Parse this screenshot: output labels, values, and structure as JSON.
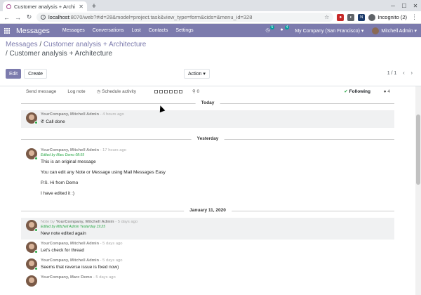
{
  "browser": {
    "tab_title": "Customer analysis + Archi",
    "url_host": "localhost",
    "url_rest": ":8070/web?#id=28&model=project.task&view_type=form&cids=&menu_id=328",
    "incognito_label": "Incognito (2)"
  },
  "navbar": {
    "app_name": "Messages",
    "menu": [
      "Messages",
      "Conversations",
      "Lost",
      "Contacts",
      "Settings"
    ],
    "activity_badge": "5",
    "chat_badge": "4",
    "company": "My Company (San Francisco)",
    "user": "Mitchell Admin"
  },
  "control_panel": {
    "breadcrumb_parent": "Messages",
    "breadcrumb_mid": "Customer analysis + Architecture",
    "breadcrumb_current": "/ Customer analysis + Architecture",
    "edit_label": "Edit",
    "create_label": "Create",
    "action_label": "Action",
    "pager": "1 / 1"
  },
  "chatter": {
    "send_message": "Send message",
    "log_note": "Log note",
    "schedule_activity": "Schedule activity",
    "attachments": "0",
    "following": "Following",
    "followers": "4"
  },
  "sections": [
    {
      "date": "Today",
      "messages": [
        {
          "author": "YourCompany, Mitchell Admin",
          "time": " - 4 hours ago",
          "body": [
            "Call done"
          ],
          "note": true
        }
      ]
    },
    {
      "date": "Yesterday",
      "messages": [
        {
          "author": "YourCompany, Mitchell Admin",
          "time": " - 17 hours ago",
          "edited": "Edited by Marc Demo 08:59",
          "body": [
            "This is an original message",
            "You can edit any Note or Message using Mail Messages Easy",
            "P.S. Hi from Demo",
            "I have edited it :)"
          ]
        }
      ]
    },
    {
      "date": "January 11, 2020",
      "messages": [
        {
          "note_lbl": "Note by ",
          "author": "YourCompany, Mitchell Admin",
          "time": " - 5 days ago",
          "edited": "Edited by Mitchell Admin Yesterday 19:25",
          "body": [
            "New note edited again"
          ],
          "note": true
        },
        {
          "author": "YourCompany, Mitchell Admin",
          "time": " - 5 days ago",
          "body": [
            "Let's check for thread"
          ]
        },
        {
          "author": "YourCompany, Mitchell Admin",
          "time": " - 5 days ago",
          "body": [
            "Seems that reverse issue is fixed now)"
          ]
        },
        {
          "author": "YourCompany, Marc Demo",
          "time": " - 5 days ago",
          "body": []
        }
      ]
    }
  ]
}
